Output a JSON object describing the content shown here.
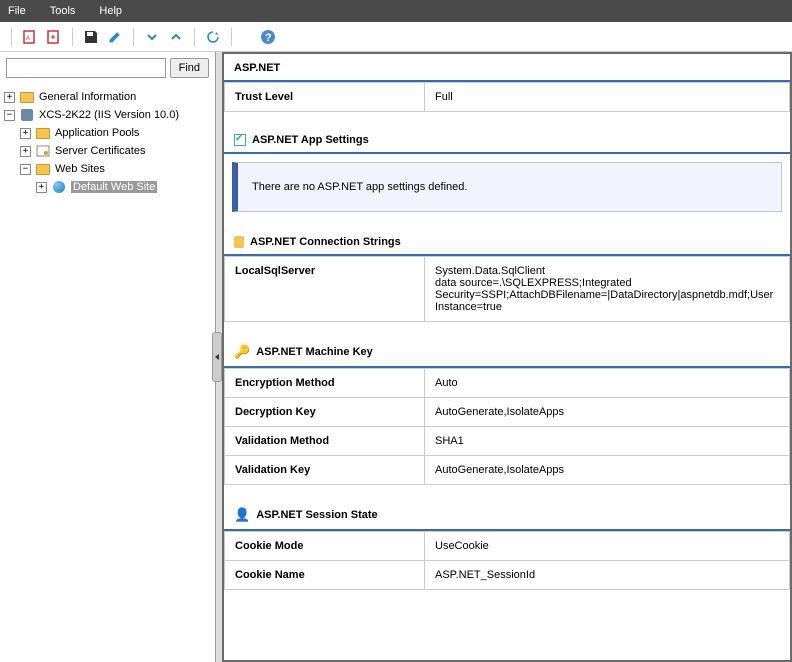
{
  "menu": {
    "file": "File",
    "tools": "Tools",
    "help": "Help"
  },
  "search": {
    "find_label": "Find",
    "value": ""
  },
  "tree": {
    "general": "General Information",
    "server": "XCS-2K22 (IIS Version 10.0)",
    "app_pools": "Application Pools",
    "server_certs": "Server Certificates",
    "web_sites": "Web Sites",
    "default_site": "Default Web Site"
  },
  "sections": {
    "aspnet": "ASP.NET",
    "trust_level": {
      "label": "Trust Level",
      "value": "Full"
    },
    "app_settings": {
      "title": "ASP.NET App Settings",
      "message": "There are no ASP.NET app settings defined."
    },
    "conn_strings": {
      "title": "ASP.NET Connection Strings"
    },
    "conn_row": {
      "name": "LocalSqlServer",
      "value": "System.Data.SqlClient\ndata source=.\\SQLEXPRESS;Integrated Security=SSPI;AttachDBFilename=|DataDirectory|aspnetdb.mdf;User Instance=true"
    },
    "machine_key": {
      "title": "ASP.NET Machine Key"
    },
    "mk_rows": [
      {
        "label": "Encryption Method",
        "value": "Auto"
      },
      {
        "label": "Decryption Key",
        "value": "AutoGenerate,IsolateApps"
      },
      {
        "label": "Validation Method",
        "value": "SHA1"
      },
      {
        "label": "Validation Key",
        "value": "AutoGenerate,IsolateApps"
      }
    ],
    "session_state": {
      "title": "ASP.NET Session State"
    },
    "ss_rows": [
      {
        "label": "Cookie Mode",
        "value": "UseCookie"
      },
      {
        "label": "Cookie Name",
        "value": "ASP.NET_SessionId"
      }
    ]
  }
}
